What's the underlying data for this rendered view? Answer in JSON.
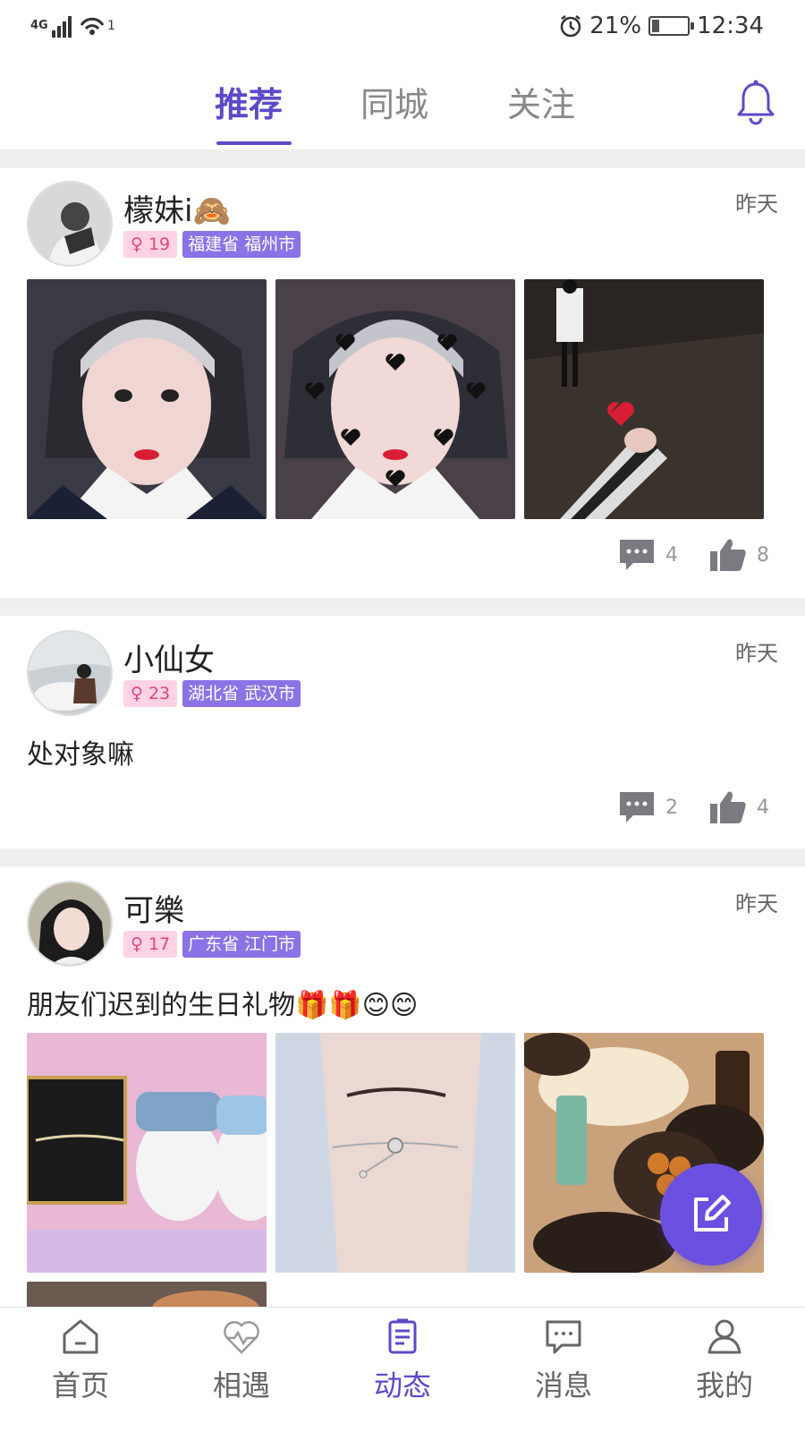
{
  "status_bar": {
    "network": "4G",
    "signal_sup": "1",
    "battery": "21%",
    "battery_level": 0.21,
    "time": "12:34"
  },
  "top_tabs": [
    "推荐",
    "同城",
    "关注"
  ],
  "active_tab_index": 0,
  "posts": [
    {
      "username": "檬妹i🙈",
      "time": "昨天",
      "age": "♀ 19",
      "location": "福建省 福州市",
      "text": "",
      "comments": "4",
      "likes": "8"
    },
    {
      "username": "小仙女",
      "time": "昨天",
      "age": "♀ 23",
      "location": "湖北省 武汉市",
      "text": "处对象嘛",
      "comments": "2",
      "likes": "4"
    },
    {
      "username": "可樂",
      "time": "昨天",
      "age": "♀ 17",
      "location": "广东省 江门市",
      "text": "朋友们迟到的生日礼物🎁🎁😊😊"
    }
  ],
  "bottom_nav": [
    "首页",
    "相遇",
    "动态",
    "消息",
    "我的"
  ],
  "active_bottom_index": 2,
  "colors": {
    "accent": "#5b4bc9",
    "fab": "#6b4fe0",
    "age_tag_bg": "#ffd3e3",
    "location_tag_bg": "#8b72e6"
  }
}
